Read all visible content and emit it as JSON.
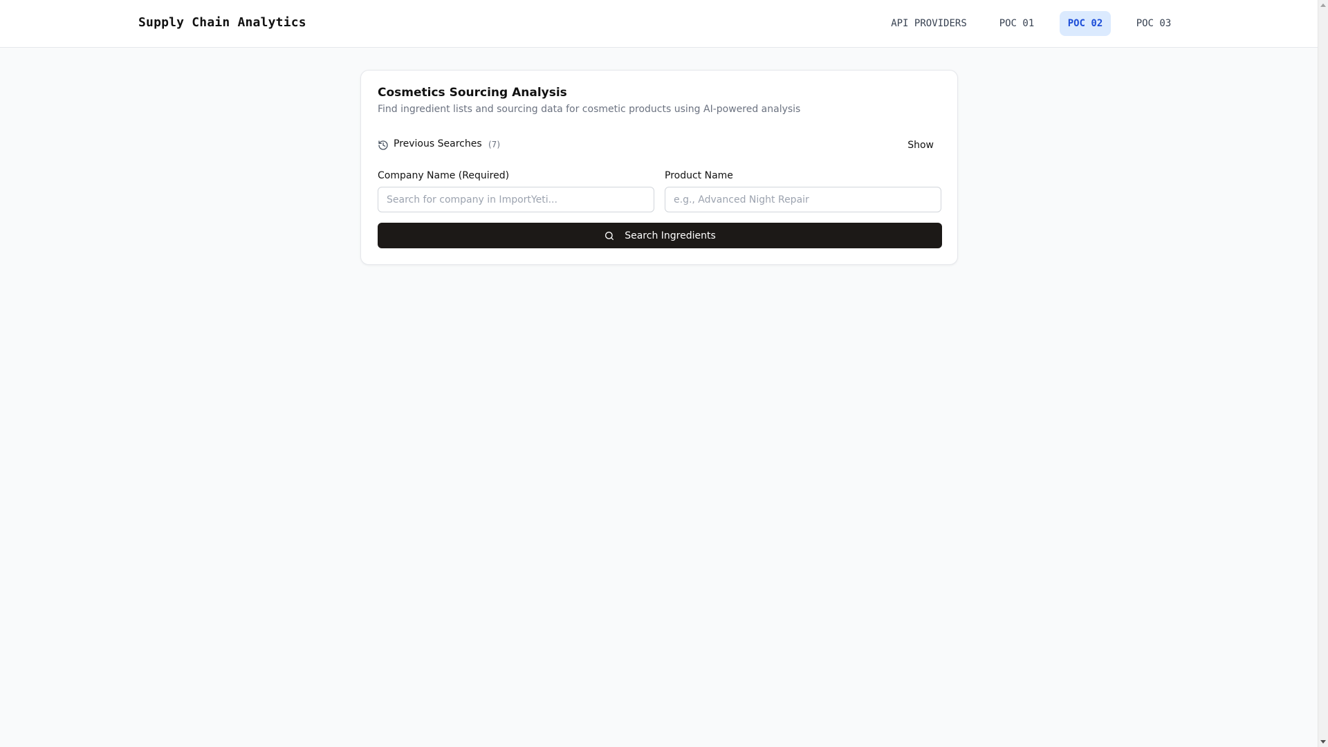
{
  "header": {
    "brand": "Supply Chain Analytics",
    "nav": [
      {
        "label": "API PROVIDERS",
        "active": false
      },
      {
        "label": "POC 01",
        "active": false
      },
      {
        "label": "POC 02",
        "active": true
      },
      {
        "label": "POC 03",
        "active": false
      }
    ]
  },
  "card": {
    "title": "Cosmetics Sourcing Analysis",
    "subtitle": "Find ingredient lists and sourcing data for cosmetic products using AI-powered analysis",
    "previous_searches": {
      "label": "Previous Searches",
      "count": "(7)",
      "toggle_label": "Show",
      "icon": "history-icon"
    },
    "company_field": {
      "label": "Company Name (Required)",
      "value": "",
      "placeholder": "Search for company in ImportYeti..."
    },
    "product_field": {
      "label": "Product Name",
      "value": "",
      "placeholder": "e.g., Advanced Night Repair"
    },
    "search_button": {
      "label": "Search Ingredients",
      "icon": "search-icon"
    }
  },
  "colors": {
    "active_nav_bg": "#dbeafe",
    "active_nav_text": "#1d4ed8",
    "button_bg": "#1c1917",
    "page_bg": "#f9fafb"
  }
}
